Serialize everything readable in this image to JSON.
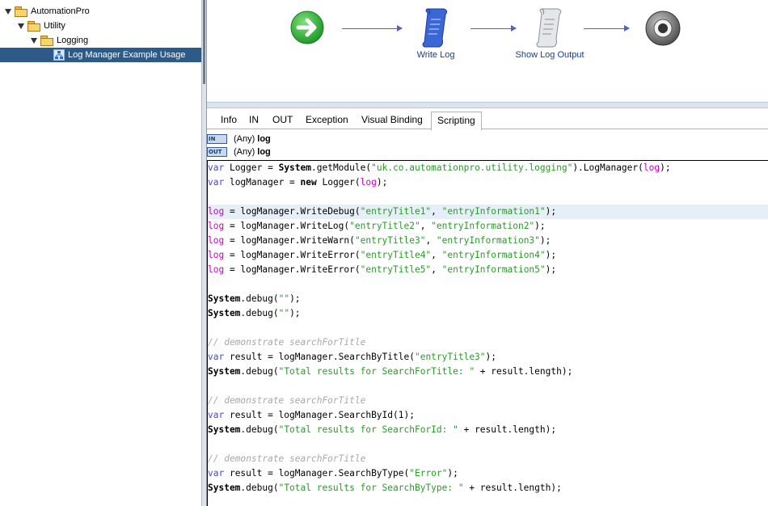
{
  "tree": {
    "root": "AutomationPro",
    "child": "Utility",
    "grandchild": "Logging",
    "selected": "Log Manager Example Usage"
  },
  "flow": {
    "nodes": [
      {
        "name": "start",
        "label": ""
      },
      {
        "name": "write-log",
        "label": "Write Log"
      },
      {
        "name": "show-log-output",
        "label": "Show Log Output"
      },
      {
        "name": "end",
        "label": ""
      }
    ]
  },
  "tabs": [
    "Info",
    "IN",
    "OUT",
    "Exception",
    "Visual Binding",
    "Scripting"
  ],
  "selected_tab": "Scripting",
  "params": {
    "in": {
      "badge": "IN",
      "type": "(Any)",
      "name": "log"
    },
    "out": {
      "badge": "OUT",
      "type": "(Any)",
      "name": "log"
    }
  },
  "code_lines": [
    "var Logger = System.getModule(\"uk.co.automationpro.utility.logging\").LogManager(log);",
    "var logManager = new Logger(log);",
    "",
    "log = logManager.WriteDebug(\"entryTitle1\", \"entryInformation1\");",
    "log = logManager.WriteLog(\"entryTitle2\", \"entryInformation2\");",
    "log = logManager.WriteWarn(\"entryTitle3\", \"entryInformation3\");",
    "log = logManager.WriteError(\"entryTitle4\", \"entryInformation4\");",
    "log = logManager.WriteError(\"entryTitle5\", \"entryInformation5\");",
    "",
    "System.debug(\"\");",
    "System.debug(\"\");",
    "",
    "// demonstrate searchForTitle",
    "var result = logManager.SearchByTitle(\"entryTitle3\");",
    "System.debug(\"Total results for SearchForTitle: \" + result.length);",
    "",
    "// demonstrate searchForTitle",
    "var result = logManager.SearchById(1);",
    "System.debug(\"Total results for SearchForId: \" + result.length);",
    "",
    "// demonstrate searchForTitle",
    "var result = logManager.SearchByType(\"Error\");",
    "System.debug(\"Total results for SearchByType: \" + result.length);"
  ],
  "colors": {
    "keyword": "#4848c8",
    "string": "#2a9a2a",
    "log_variable": "#cc00cc",
    "comment": "#a8a8a8",
    "selection": "#2d5a87"
  }
}
